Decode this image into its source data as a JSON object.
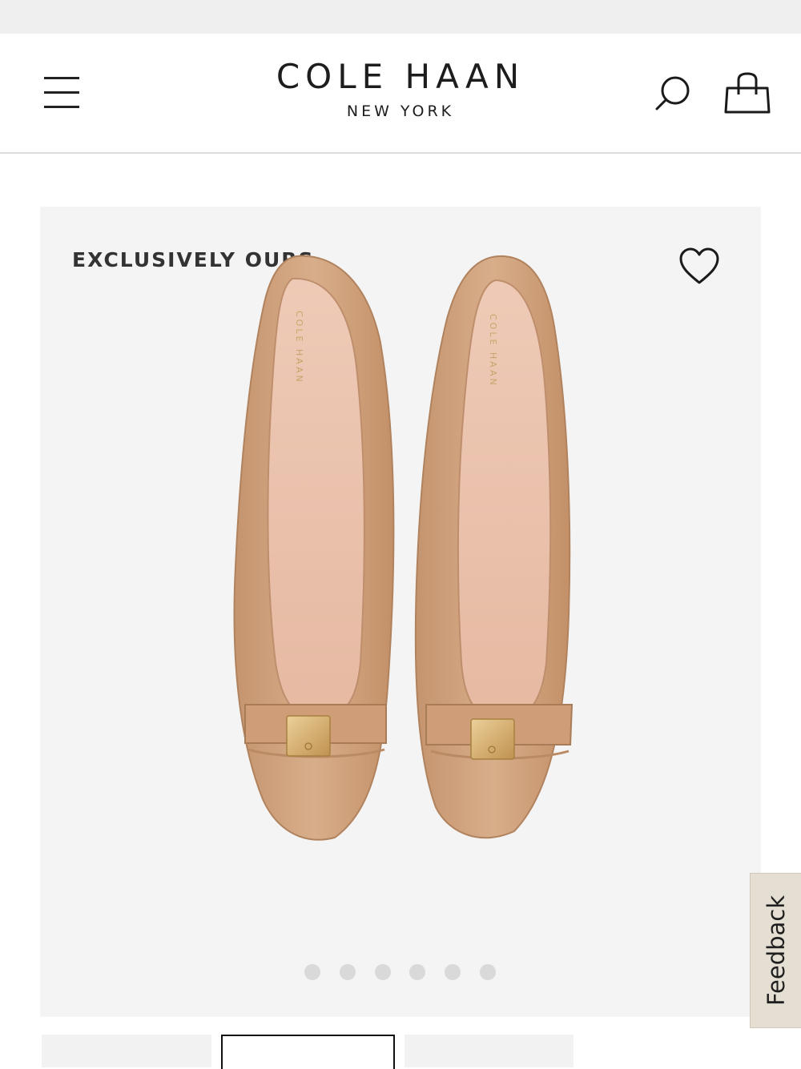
{
  "header": {
    "brand_name": "COLE HAAN",
    "brand_location": "NEW YORK"
  },
  "product": {
    "badge": "EXCLUSIVELY OURS",
    "image_subject": "tan leather ballet flats with gold bow buckle",
    "insole_brand": "COLE HAAN",
    "gallery": {
      "image_count": 6,
      "active_index": 0
    }
  },
  "feedback": {
    "label": "Feedback"
  },
  "thumbnails": {
    "selected_index": 1
  },
  "icons": {
    "menu": "hamburger-menu-icon",
    "search": "search-icon",
    "bag": "shopping-bag-icon",
    "wishlist": "heart-icon"
  },
  "colors": {
    "background": "#ffffff",
    "card_background": "#f4f4f4",
    "feedback_tab": "#e4dfd2",
    "leather": "#cfa37f",
    "buckle_gold": "#d4aa6e"
  }
}
